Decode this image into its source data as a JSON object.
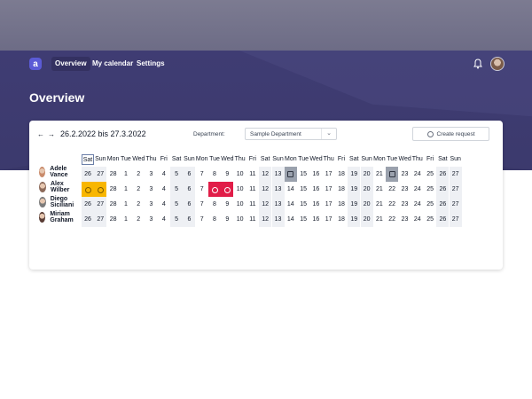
{
  "nav": {
    "logo": "a",
    "items": [
      {
        "label": "Overview",
        "active": true
      },
      {
        "label": "My calendar",
        "active": false
      },
      {
        "label": "Settings",
        "active": false
      }
    ]
  },
  "page_title": "Overview",
  "toolbar": {
    "range": "26.2.2022 bis 27.3.2022",
    "department_label": "Department:",
    "department_value": "Sample Department",
    "create_label": "Create request"
  },
  "calendar": {
    "day_headers": [
      "Sat",
      "Sun",
      "Mon",
      "Tue",
      "Wed",
      "Thu",
      "Fri",
      "Sat",
      "Sun",
      "Mon",
      "Tue",
      "Wed",
      "Thu",
      "Fri",
      "Sat",
      "Sun",
      "Mon",
      "Tue",
      "Wed",
      "Thu",
      "Fri",
      "Sat",
      "Sun",
      "Mon",
      "Tue",
      "Wed",
      "Thu",
      "Fri",
      "Sat",
      "Sun"
    ],
    "dates": [
      "26",
      "27",
      "28",
      "1",
      "2",
      "3",
      "4",
      "5",
      "6",
      "7",
      "8",
      "9",
      "10",
      "11",
      "12",
      "13",
      "14",
      "15",
      "16",
      "17",
      "18",
      "19",
      "20",
      "21",
      "22",
      "23",
      "24",
      "25",
      "26",
      "27"
    ],
    "weekend_indexes": [
      0,
      1,
      7,
      8,
      14,
      15,
      21,
      22,
      28,
      29
    ],
    "people": [
      {
        "name": "Adele Vance",
        "avatar_color": "#c98b6b",
        "marks": [
          {
            "index": 16,
            "type": "pending"
          },
          {
            "index": 24,
            "type": "pending"
          }
        ]
      },
      {
        "name": "Alex Wilber",
        "avatar_color": "#8c6a5a",
        "marks": [
          {
            "index": 0,
            "type": "vac-yellow"
          },
          {
            "index": 1,
            "type": "vac-yellow"
          },
          {
            "index": 10,
            "type": "vac-red"
          },
          {
            "index": 11,
            "type": "vac-red"
          }
        ]
      },
      {
        "name": "Diego Siciliani",
        "avatar_color": "#7b7b7b",
        "marks": []
      },
      {
        "name": "Miriam Graham",
        "avatar_color": "#5b3e36",
        "marks": []
      }
    ]
  }
}
